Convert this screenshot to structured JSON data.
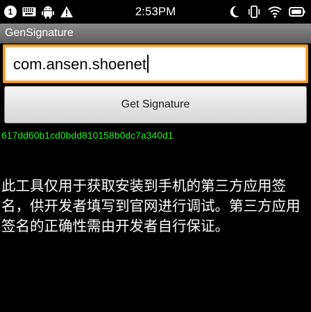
{
  "status_bar": {
    "notification_badge": "1",
    "time": "2:53PM",
    "icons_left": [
      "notification-badge-icon",
      "keyboard-icon",
      "android-icon",
      "warning-icon"
    ],
    "icons_right": [
      "moon-icon",
      "vibrate-icon",
      "wifi-icon",
      "battery-icon"
    ]
  },
  "title_bar": {
    "title": "GenSignature"
  },
  "package_input": {
    "value": "com.ansen.shoenet"
  },
  "get_button": {
    "label": "Get Signature"
  },
  "signature_result": "617dd60b1cd0bdd810158b0dc7a340d1",
  "description": "此工具仅用于获取安装到手机的第三方应用签名，供开发者填写到官网进行调试。第三方应用签名的正确性需由开发者自行保证。",
  "colors": {
    "signature_text": "#22ee22",
    "input_border": "#f0961e",
    "title_bar": "#6f6f6f"
  }
}
